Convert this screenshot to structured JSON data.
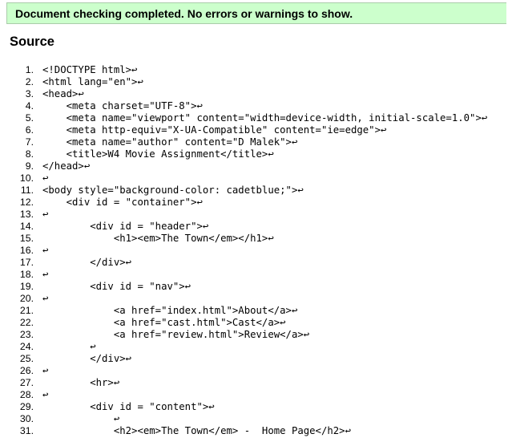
{
  "banner": {
    "message": "Document checking completed. No errors or warnings to show."
  },
  "source": {
    "heading": "Source",
    "line_end_marker": "↩",
    "lines": [
      {
        "n": "1.",
        "code": "<!DOCTYPE html>↩"
      },
      {
        "n": "2.",
        "code": "<html lang=\"en\">↩"
      },
      {
        "n": "3.",
        "code": "<head>↩"
      },
      {
        "n": "4.",
        "code": "    <meta charset=\"UTF-8\">↩"
      },
      {
        "n": "5.",
        "code": "    <meta name=\"viewport\" content=\"width=device-width, initial-scale=1.0\">↩"
      },
      {
        "n": "6.",
        "code": "    <meta http-equiv=\"X-UA-Compatible\" content=\"ie=edge\">↩"
      },
      {
        "n": "7.",
        "code": "    <meta name=\"author\" content=\"D Malek\">↩"
      },
      {
        "n": "8.",
        "code": "    <title>W4 Movie Assignment</title>↩"
      },
      {
        "n": "9.",
        "code": "</head>↩"
      },
      {
        "n": "10.",
        "code": "↩"
      },
      {
        "n": "11.",
        "code": "<body style=\"background-color: cadetblue;\">↩"
      },
      {
        "n": "12.",
        "code": "    <div id = \"container\">↩"
      },
      {
        "n": "13.",
        "code": "↩"
      },
      {
        "n": "14.",
        "code": "        <div id = \"header\">↩"
      },
      {
        "n": "15.",
        "code": "            <h1><em>The Town</em></h1>↩"
      },
      {
        "n": "16.",
        "code": "↩"
      },
      {
        "n": "17.",
        "code": "        </div>↩"
      },
      {
        "n": "18.",
        "code": "↩"
      },
      {
        "n": "19.",
        "code": "        <div id = \"nav\">↩"
      },
      {
        "n": "20.",
        "code": "↩"
      },
      {
        "n": "21.",
        "code": "            <a href=\"index.html\">About</a>↩"
      },
      {
        "n": "22.",
        "code": "            <a href=\"cast.html\">Cast</a>↩"
      },
      {
        "n": "23.",
        "code": "            <a href=\"review.html\">Review</a>↩"
      },
      {
        "n": "24.",
        "code": "        ↩"
      },
      {
        "n": "25.",
        "code": "        </div>↩"
      },
      {
        "n": "26.",
        "code": "↩"
      },
      {
        "n": "27.",
        "code": "        <hr>↩"
      },
      {
        "n": "28.",
        "code": "↩"
      },
      {
        "n": "29.",
        "code": "        <div id = \"content\">↩"
      },
      {
        "n": "30.",
        "code": "            ↩"
      },
      {
        "n": "31.",
        "code": "            <h2><em>The Town</em> -  Home Page</h2>↩"
      }
    ]
  }
}
